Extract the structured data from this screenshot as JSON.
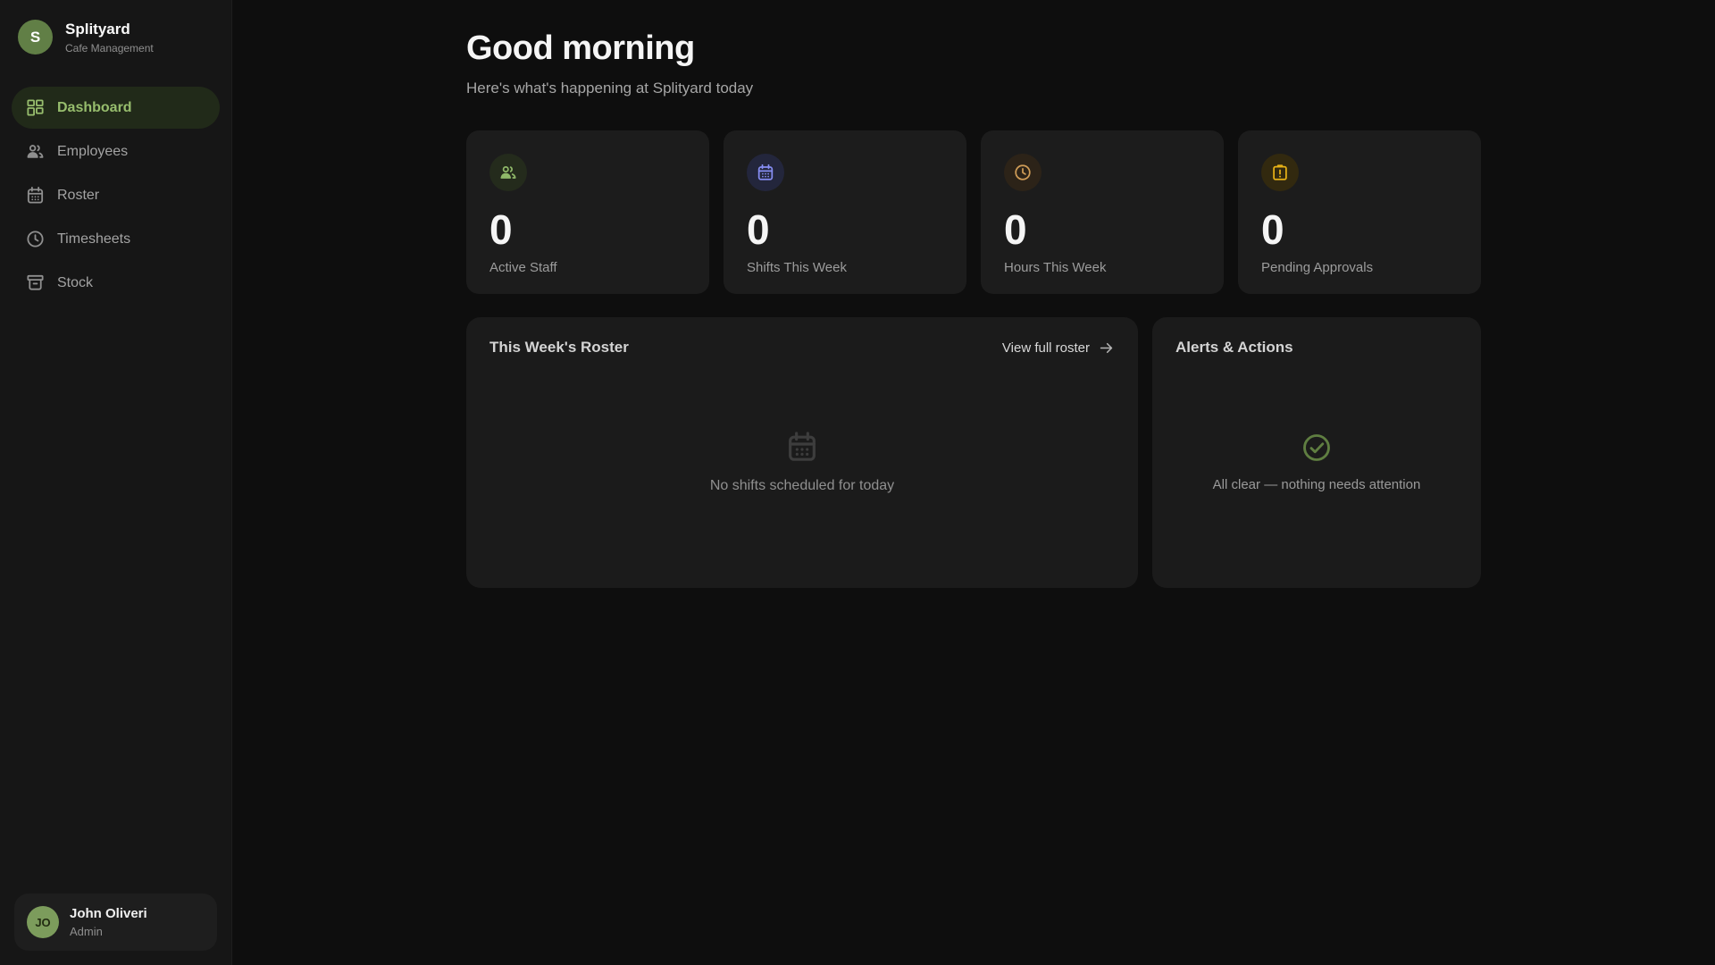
{
  "brand": {
    "name": "Splityard",
    "subtitle": "Cafe Management",
    "initial": "S",
    "accent_color": "#617f46"
  },
  "sidebar": {
    "items": [
      {
        "label": "Dashboard",
        "icon": "dashboard-icon",
        "active": true
      },
      {
        "label": "Employees",
        "icon": "people-icon",
        "active": false
      },
      {
        "label": "Roster",
        "icon": "calendar-icon",
        "active": false
      },
      {
        "label": "Timesheets",
        "icon": "clock-icon",
        "active": false
      },
      {
        "label": "Stock",
        "icon": "archive-icon",
        "active": false
      }
    ],
    "active_text_color": "#97bd6d"
  },
  "user": {
    "name": "John Oliveri",
    "role": "Admin",
    "initials": "JO"
  },
  "header": {
    "greeting": "Good morning",
    "subtitle": "Here's what's happening at Splityard today"
  },
  "stats": [
    {
      "value": "0",
      "label": "Active Staff",
      "icon": "people-icon",
      "icon_color": "#8fb869",
      "icon_bg": "#242b1c"
    },
    {
      "value": "0",
      "label": "Shifts This Week",
      "icon": "calendar-icon",
      "icon_color": "#868df2",
      "icon_bg": "#23263c"
    },
    {
      "value": "0",
      "label": "Hours This Week",
      "icon": "clock-icon",
      "icon_color": "#cf9c57",
      "icon_bg": "#2c2318"
    },
    {
      "value": "0",
      "label": "Pending Approvals",
      "icon": "clipboard-alert-icon",
      "icon_color": "#e7b117",
      "icon_bg": "#32290f"
    }
  ],
  "roster_panel": {
    "title": "This Week's Roster",
    "link_label": "View full roster",
    "empty_text": "No shifts scheduled for today"
  },
  "alerts_panel": {
    "title": "Alerts & Actions",
    "empty_text": "All clear — nothing needs attention",
    "check_color": "#5f7e41"
  }
}
